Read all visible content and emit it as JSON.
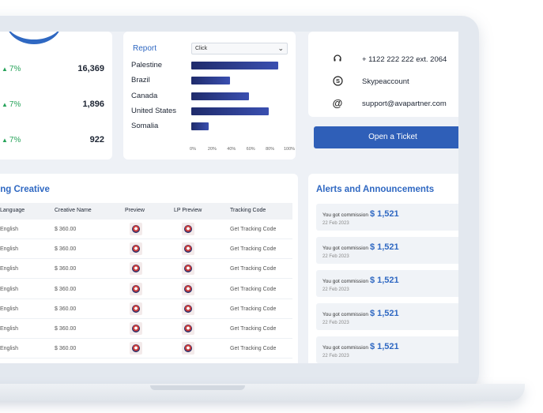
{
  "stats": {
    "rows": [
      {
        "change": "7%",
        "value": "16,369"
      },
      {
        "change": "7%",
        "value": "1,896"
      },
      {
        "change": "7%",
        "value": "922"
      }
    ],
    "up_color": "#27a35a"
  },
  "report": {
    "title": "Report",
    "select_value": "Click",
    "chart_data": {
      "type": "bar",
      "orientation": "horizontal",
      "categories": [
        "Palestine",
        "Brazil",
        "Canada",
        "United States",
        "Somalia"
      ],
      "values": [
        90,
        40,
        60,
        80,
        18
      ],
      "x_ticks": [
        "0%",
        "20%",
        "40%",
        "60%",
        "80%",
        "100%"
      ],
      "xlim": [
        0,
        100
      ],
      "bar_color": "#27357f"
    }
  },
  "contact": {
    "phone": "+ 1122 222 222 ext. 2064",
    "skype": "Skypeaccount",
    "email": "support@avapartner.com",
    "ticket_button": "Open a Ticket",
    "phone_icon": "headset-icon",
    "skype_icon": "skype-icon",
    "email_icon": "at-icon"
  },
  "creative": {
    "title": "ning Creative",
    "headers": [
      "Language",
      "Creative Name",
      "Preview",
      "LP Preview",
      "Tracking Code"
    ],
    "rows": [
      {
        "language": "English",
        "name": "$ 360.00",
        "tracking": "Get Tracking Code"
      },
      {
        "language": "English",
        "name": "$ 360.00",
        "tracking": "Get Tracking Code"
      },
      {
        "language": "English",
        "name": "$ 360.00",
        "tracking": "Get Tracking Code"
      },
      {
        "language": "English",
        "name": "$ 360.00",
        "tracking": "Get Tracking Code"
      },
      {
        "language": "English",
        "name": "$ 360.00",
        "tracking": "Get Tracking Code"
      },
      {
        "language": "English",
        "name": "$ 360.00",
        "tracking": "Get Tracking Code"
      },
      {
        "language": "English",
        "name": "$ 360.00",
        "tracking": "Get Tracking Code"
      }
    ]
  },
  "alerts": {
    "title": "Alerts and Announcements",
    "items": [
      {
        "text": "You got commission",
        "amount": "$ 1,521",
        "date": "22 Feb 2023"
      },
      {
        "text": "You got commission",
        "amount": "$ 1,521",
        "date": "22 Feb 2023"
      },
      {
        "text": "You got commission",
        "amount": "$ 1,521",
        "date": "22 Feb 2023"
      },
      {
        "text": "You got commission",
        "amount": "$ 1,521",
        "date": "22 Feb 2023"
      },
      {
        "text": "You got commission",
        "amount": "$ 1,521",
        "date": "22 Feb 2023"
      }
    ]
  },
  "accent_color": "#2f68c2",
  "button_color": "#2f5fb8"
}
